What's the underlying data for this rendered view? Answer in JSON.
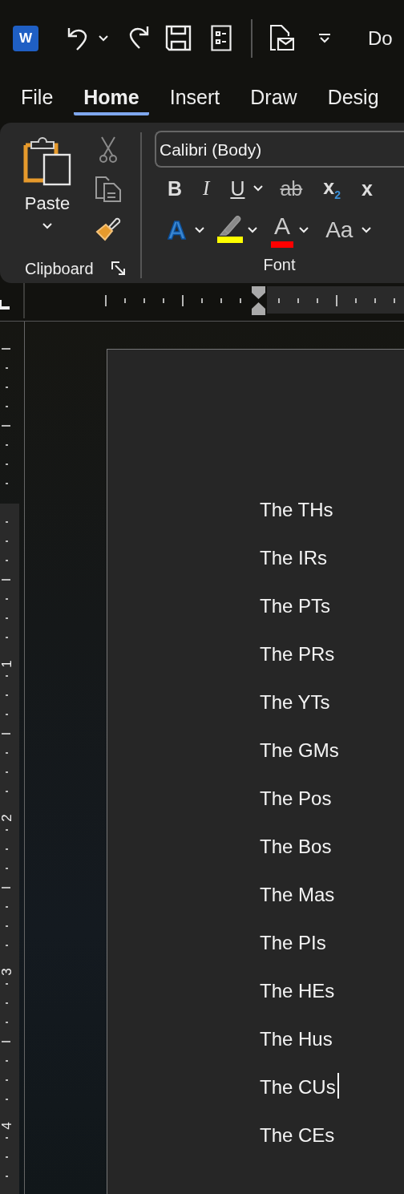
{
  "title_bar": {
    "logo_letter": "W",
    "title": "Do"
  },
  "tabs": [
    {
      "label": "File",
      "selected": false
    },
    {
      "label": "Home",
      "selected": true
    },
    {
      "label": "Insert",
      "selected": false
    },
    {
      "label": "Draw",
      "selected": false
    },
    {
      "label": "Desig",
      "selected": false
    }
  ],
  "ribbon": {
    "clipboard": {
      "paste_label": "Paste",
      "group_label": "Clipboard"
    },
    "font": {
      "font_name": "Calibri (Body)",
      "group_label": "Font",
      "row_1": [
        {
          "kind": "bold",
          "glyph": "B",
          "dropdown": false
        },
        {
          "kind": "italic",
          "glyph": "I",
          "dropdown": false
        },
        {
          "kind": "underline",
          "glyph": "U",
          "dropdown": true
        },
        {
          "kind": "strikethrough",
          "glyph": "ab",
          "dropdown": false
        },
        {
          "kind": "subscript",
          "glyph": "x",
          "sub": "2",
          "dropdown": false
        },
        {
          "kind": "superscript",
          "glyph": "x",
          "dropdown": false
        }
      ],
      "row_2": [
        {
          "kind": "effects",
          "glyph": "A",
          "dropdown": true
        },
        {
          "kind": "highlight",
          "color": "#ffff00",
          "dropdown": true
        },
        {
          "kind": "font_color",
          "glyph": "A",
          "color": "#ff0000",
          "dropdown": true
        },
        {
          "kind": "case",
          "glyph": "Aa",
          "dropdown": true
        }
      ]
    }
  },
  "vertical_ruler": {
    "labels": [
      "1",
      "2",
      "3",
      "4"
    ]
  },
  "document": {
    "lines": [
      {
        "text": "The THs",
        "cursor": false
      },
      {
        "text": "The IRs",
        "cursor": false
      },
      {
        "text": "The PTs",
        "cursor": false
      },
      {
        "text": "The PRs",
        "cursor": false
      },
      {
        "text": "The YTs",
        "cursor": false
      },
      {
        "text": "The GMs",
        "cursor": false
      },
      {
        "text": "The Pos",
        "cursor": false
      },
      {
        "text": "The Bos",
        "cursor": false
      },
      {
        "text": "The Mas",
        "cursor": false
      },
      {
        "text": "The PIs",
        "cursor": false
      },
      {
        "text": "The HEs",
        "cursor": false
      },
      {
        "text": "The Hus",
        "cursor": false
      },
      {
        "text": "The CUs",
        "cursor": true
      },
      {
        "text": "The CEs",
        "cursor": false
      }
    ]
  }
}
